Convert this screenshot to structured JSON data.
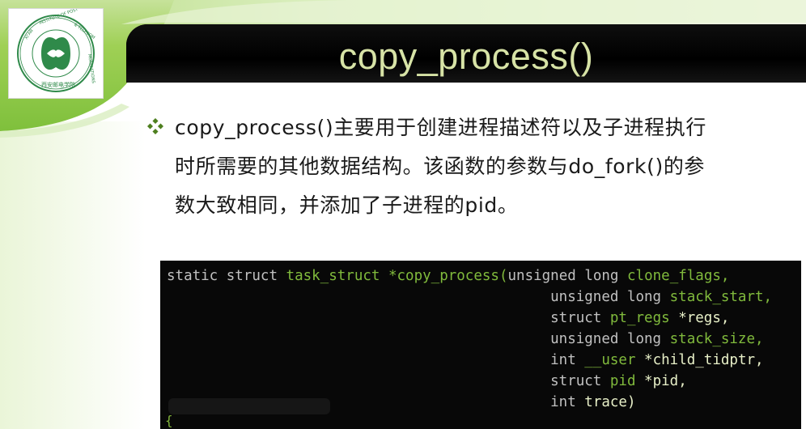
{
  "slide": {
    "title": "copy_process()",
    "bullet_lines": [
      "copy_process()主要用于创建进程描述符以及子进程执行",
      "时所需要的其他数据结构。该函数的参数与do_fork()的参",
      "数大致相同，并添加了子进程的pid。"
    ],
    "bullet_icon": "diamond-bullet-icon"
  },
  "logo": {
    "icon": "university-seal-icon",
    "ring_text_top": "XI'AN INSTITUTE OF POST & TELECOMMUNICATIONS",
    "ring_text_bottom": "西安邮电学院"
  },
  "code": {
    "line1": {
      "static": "static",
      "struct": "struct",
      "type": "task_struct",
      "func": "*copy_process(",
      "param_type": "unsigned long",
      "param_name": "clone_flags,"
    },
    "line2": {
      "param_type": "unsigned long",
      "param_name": "stack_start,"
    },
    "line3": {
      "struct": "struct",
      "type": "pt_regs",
      "param_name": "*regs,"
    },
    "line4": {
      "param_type": "unsigned long",
      "param_name": "stack_size,"
    },
    "line5": {
      "param_type": "int",
      "attr": "__user",
      "param_name": "*child_tidptr,"
    },
    "line6": {
      "struct": "struct",
      "type": "pid",
      "param_name": "*pid,"
    },
    "line7": {
      "param_type": "int",
      "param_name": "trace)"
    },
    "line8": {
      "text": "{"
    }
  },
  "colors": {
    "title_text": "#d7e3a6",
    "title_bar": "#050505",
    "green_band": "#8dc63f",
    "code_bg": "#080808",
    "code_keyword": "#80ba3c"
  }
}
